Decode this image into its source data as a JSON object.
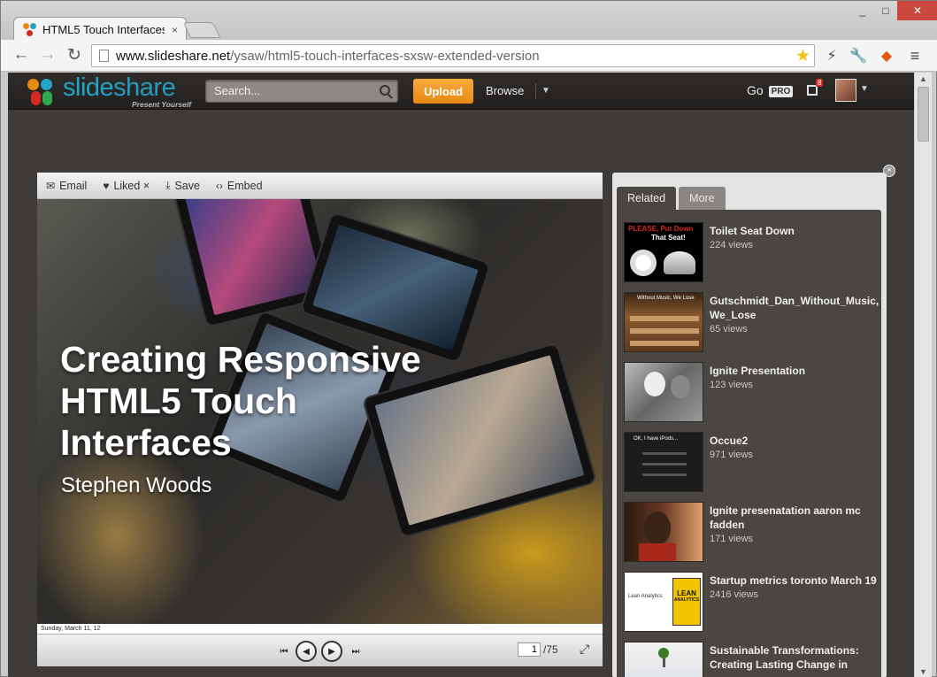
{
  "browser": {
    "tab_title": "HTML5 Touch Interfaces:",
    "tab_close": "×",
    "url_domain": "www.slideshare.net",
    "url_path": "/ysaw/html5-touch-interfaces-sxsw-extended-version",
    "win_minimize": "_",
    "win_maximize": "□",
    "win_close": "✕"
  },
  "header": {
    "logo_text_1": "slide",
    "logo_text_2": "share",
    "logo_tagline": "Present Yourself",
    "search_placeholder": "Search...",
    "upload_label": "Upload",
    "browse_label": "Browse",
    "go_label": "Go",
    "pro_label": "PRO",
    "notification_count": "8"
  },
  "player": {
    "toolbar": {
      "email_label": "Email",
      "liked_label": "Liked ×",
      "save_label": "Save",
      "embed_label": "Embed"
    },
    "slide": {
      "title_line1": "Creating Responsive",
      "title_line2": "HTML5 Touch",
      "title_line3": "Interfaces",
      "author": "Stephen Woods",
      "footer_date": "Sunday, March 11, 12"
    },
    "current_page": "1",
    "total_pages": "/75"
  },
  "sidebar": {
    "tabs": [
      {
        "label": "Related"
      },
      {
        "label": "More"
      }
    ],
    "items": [
      {
        "title": "Toilet Seat Down",
        "views": "224 views"
      },
      {
        "title": "Gutschmidt_Dan_Without_Music, We_Lose",
        "views": "65 views"
      },
      {
        "title": "Ignite Presentation",
        "views": "123 views"
      },
      {
        "title": "Occue2",
        "views": "971 views"
      },
      {
        "title": "Ignite presenatation aaron mc fadden",
        "views": "171 views"
      },
      {
        "title": "Startup metrics toronto March 19",
        "views": "2416 views"
      },
      {
        "title": "Sustainable Transformations: Creating Lasting Change in",
        "views": ""
      }
    ],
    "thumb_texts": {
      "t1_line1": "PLEASE, Put Down",
      "t1_line2": "That Seat!",
      "t2": "Without Music, We Lose",
      "t4_line1": "OK, I have iPods...",
      "t6_line1": "Lean Analytics",
      "t6_line2": "LEAN",
      "t6_line3": "ANALYTICS"
    }
  },
  "colors": {
    "accent_orange": "#e88a12",
    "logo_blue": "#21a4c8",
    "page_bg": "#3f3b38"
  }
}
